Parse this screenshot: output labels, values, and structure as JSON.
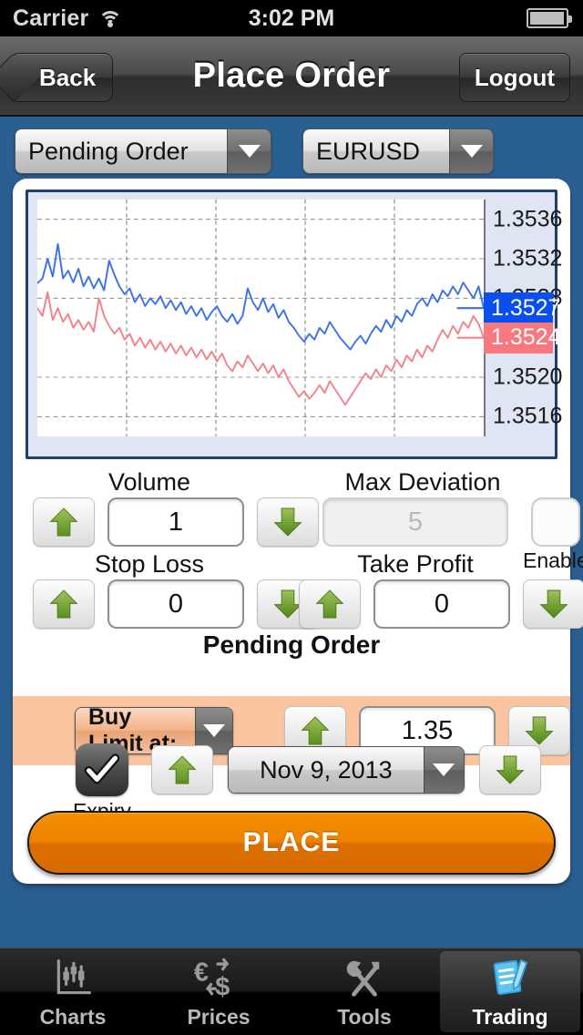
{
  "statusbar": {
    "carrier": "Carrier",
    "time": "3:02 PM",
    "wifi_icon": "wifi-icon",
    "battery_icon": "battery-icon"
  },
  "navbar": {
    "back_label": "Back",
    "title": "Place Order",
    "logout_label": "Logout"
  },
  "selectors": {
    "order_type": {
      "value": "Pending Order",
      "caret_icon": "chevron-down-icon"
    },
    "symbol": {
      "value": "EURUSD",
      "caret_icon": "chevron-down-icon"
    }
  },
  "chart_data": {
    "type": "line",
    "title": "",
    "xlabel": "",
    "ylabel": "",
    "grid": true,
    "legend_position": "none",
    "ylim": [
      1.3514,
      1.3538
    ],
    "yticks": [
      "1.3536",
      "1.3532",
      "1.3528",
      "1.3520",
      "1.3516"
    ],
    "ytick_values": [
      1.3536,
      1.3532,
      1.3528,
      1.352,
      1.3516
    ],
    "price_tags": [
      {
        "name": "bid",
        "label": "1.3527",
        "value": 1.3527,
        "color": "#0b4ff0"
      },
      {
        "name": "ask",
        "label": "1.3524",
        "value": 1.3524,
        "color": "#f7797f"
      }
    ],
    "series": [
      {
        "name": "bid",
        "color": "#3b72e8",
        "values": [
          1.35295,
          1.353,
          1.3532,
          1.35302,
          1.35335,
          1.353,
          1.35308,
          1.35296,
          1.3531,
          1.35292,
          1.35302,
          1.3529,
          1.353,
          1.35288,
          1.35318,
          1.35304,
          1.35292,
          1.35284,
          1.3529,
          1.35276,
          1.35284,
          1.35272,
          1.3528,
          1.35274,
          1.35282,
          1.3527,
          1.35278,
          1.35268,
          1.35276,
          1.35264,
          1.35272,
          1.35262,
          1.3527,
          1.35258,
          1.35266,
          1.35272,
          1.35262,
          1.35256,
          1.35264,
          1.35254,
          1.35262,
          1.3529,
          1.35276,
          1.35268,
          1.3528,
          1.35266,
          1.35274,
          1.3526,
          1.35268,
          1.35256,
          1.3525,
          1.35242,
          1.35236,
          1.35244,
          1.35238,
          1.3525,
          1.35244,
          1.35256,
          1.35248,
          1.3524,
          1.35234,
          1.35228,
          1.35236,
          1.35242,
          1.35234,
          1.35244,
          1.35252,
          1.35246,
          1.35258,
          1.3525,
          1.35262,
          1.35256,
          1.35268,
          1.35262,
          1.35274,
          1.3528,
          1.35272,
          1.35284,
          1.35276,
          1.35288,
          1.35282,
          1.35292,
          1.35284,
          1.35296,
          1.35288,
          1.3528,
          1.35292,
          1.3527
        ]
      },
      {
        "name": "ask",
        "color": "#f4828a",
        "values": [
          1.3527,
          1.35262,
          1.35286,
          1.35258,
          1.3527,
          1.35256,
          1.35264,
          1.3525,
          1.35258,
          1.35248,
          1.35256,
          1.35246,
          1.3528,
          1.35262,
          1.35252,
          1.35244,
          1.3525,
          1.35238,
          1.35244,
          1.35232,
          1.3524,
          1.3523,
          1.35238,
          1.35228,
          1.35236,
          1.35226,
          1.35234,
          1.35224,
          1.35232,
          1.35222,
          1.3523,
          1.3522,
          1.35228,
          1.35218,
          1.35226,
          1.35216,
          1.35224,
          1.35212,
          1.35206,
          1.35216,
          1.3521,
          1.35222,
          1.35214,
          1.35206,
          1.35214,
          1.35204,
          1.35212,
          1.352,
          1.35208,
          1.35196,
          1.35188,
          1.3518,
          1.35186,
          1.35178,
          1.35184,
          1.35192,
          1.35184,
          1.35196,
          1.35188,
          1.3518,
          1.35172,
          1.3518,
          1.35188,
          1.35196,
          1.35204,
          1.35198,
          1.35208,
          1.352,
          1.35212,
          1.35206,
          1.35218,
          1.3521,
          1.35222,
          1.35216,
          1.35228,
          1.3522,
          1.35232,
          1.35226,
          1.35238,
          1.35248,
          1.3524,
          1.35252,
          1.35244,
          1.35256,
          1.3525,
          1.35262,
          1.35254,
          1.3524
        ]
      }
    ]
  },
  "fields": {
    "volume": {
      "label": "Volume",
      "value": "1",
      "up_icon": "arrow-up-icon",
      "down_icon": "arrow-down-icon"
    },
    "max_deviation": {
      "label": "Max Deviation",
      "value": "5",
      "disabled": true,
      "enable_label": "Enable",
      "enable_checked": false
    },
    "stop_loss": {
      "label": "Stop Loss",
      "value": "0",
      "up_icon": "arrow-up-icon",
      "down_icon": "arrow-down-icon"
    },
    "take_profit": {
      "label": "Take Profit",
      "value": "0",
      "up_icon": "arrow-up-icon",
      "down_icon": "arrow-down-icon"
    }
  },
  "pending_order": {
    "title": "Pending Order",
    "type_value": "Buy Limit at:",
    "price_value": "1.35",
    "band_color": "#fac4a0"
  },
  "expiry": {
    "label": "Expiry",
    "checked": true,
    "date_value": "Nov 9, 2013",
    "check_icon": "check-icon"
  },
  "place_button": {
    "label": "PLACE",
    "color": "#e87e00"
  },
  "tabbar": {
    "tabs": [
      {
        "label": "Charts",
        "icon": "bar-chart-icon",
        "active": false
      },
      {
        "label": "Prices",
        "icon": "currency-icon",
        "active": false
      },
      {
        "label": "Tools",
        "icon": "tools-icon",
        "active": false
      },
      {
        "label": "Trading",
        "icon": "order-pad-icon",
        "active": true
      }
    ]
  }
}
